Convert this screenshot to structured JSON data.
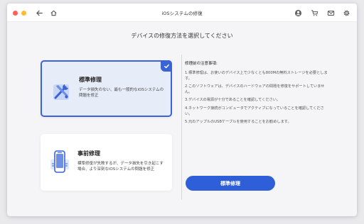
{
  "window": {
    "title": "iOSシステムの修復"
  },
  "subtitle": "デバイスの修復方法を選択してください",
  "options": [
    {
      "title": "標準修理",
      "description": "データ損失のない、最も一般的なiOSシステムの問題を修正",
      "selected": true,
      "icon": "tools-icon"
    },
    {
      "title": "事前修理",
      "description": "標準修復が失敗するが、データ損失を引き起こす場合、より深刻なiOSシステムの問題を修正",
      "selected": false,
      "icon": "phone-repair-icon"
    }
  ],
  "notes": {
    "heading": "修理前の注意事項:",
    "items": [
      "1.標準修理は、お使いのデバイス上で少なくとも800Mの無料ストレージを必要とします。",
      "2.このソフトウェアは、デバイスのハードウェアの問題を修復をサポートしていません。",
      "3.デバイスの電源が十分であることを確認してください。",
      "4.ネットワーク接続がコンピュータでアクティブになっていることを確認してください。",
      "5.元のアップルのUSBケーブルを使用することをお勧めします。"
    ]
  },
  "primary_button": "標準修理",
  "colors": {
    "accent": "#2f5fd8",
    "selected_bg": "#e7ecf9"
  }
}
